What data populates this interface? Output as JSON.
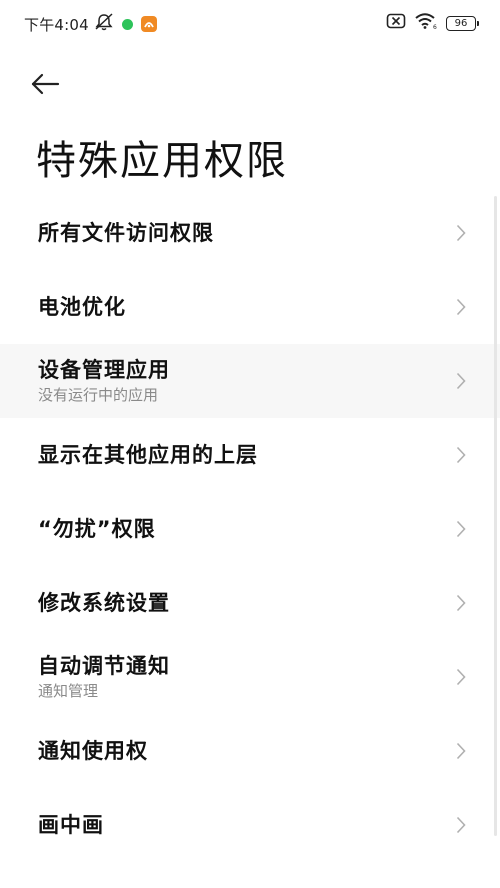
{
  "status_bar": {
    "time": "下午4:04",
    "battery": "96",
    "icons": [
      "mute-notification-icon",
      "green-dot-icon",
      "app-icon",
      "sim-disabled-icon",
      "wifi-icon",
      "battery-icon"
    ]
  },
  "header": {
    "back_icon": "arrow-left-icon",
    "title": "特殊应用权限"
  },
  "items": [
    {
      "title": "所有文件访问权限",
      "subtitle": ""
    },
    {
      "title": "电池优化",
      "subtitle": ""
    },
    {
      "title": "设备管理应用",
      "subtitle": "没有运行中的应用"
    },
    {
      "title": "显示在其他应用的上层",
      "subtitle": ""
    },
    {
      "title": "“勿扰”权限",
      "subtitle": ""
    },
    {
      "title": "修改系统设置",
      "subtitle": ""
    },
    {
      "title": "自动调节通知",
      "subtitle": "通知管理"
    },
    {
      "title": "通知使用权",
      "subtitle": ""
    },
    {
      "title": "画中画",
      "subtitle": ""
    }
  ],
  "colors": {
    "title": "#111111",
    "subtitle": "#8a8a8a",
    "chevron": "#b0b0b0",
    "highlight_row": "#f7f7f7",
    "status_green": "#2dc35a",
    "app_badge": "#f08a24"
  }
}
